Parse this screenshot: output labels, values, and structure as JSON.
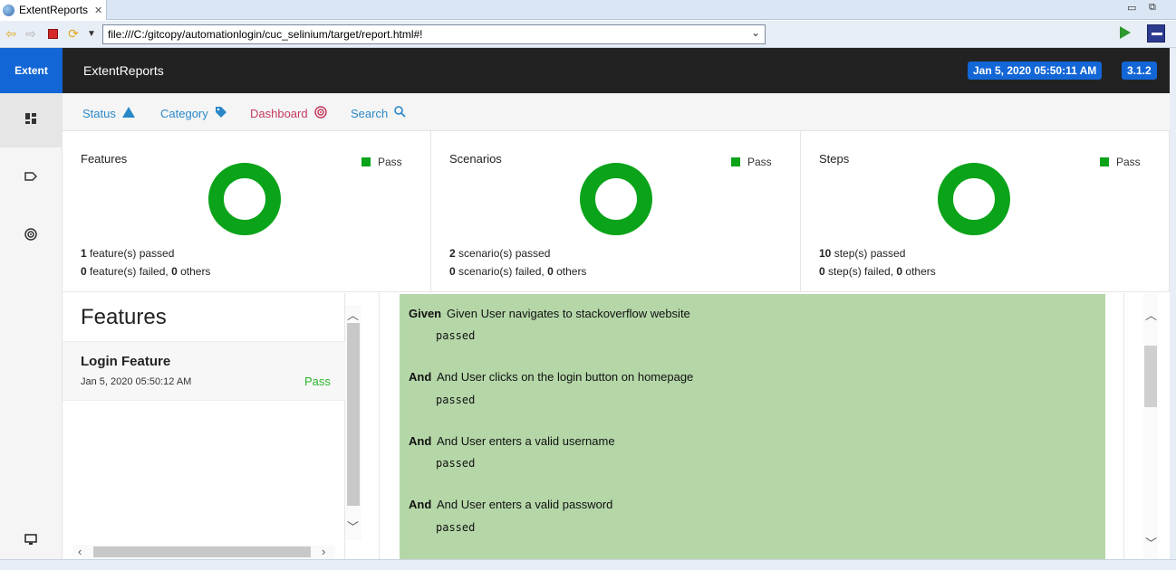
{
  "browser": {
    "tab_title": "ExtentReports",
    "url": "file:///C:/gitcopy/automationlogin/cuc_selinium/target/report.html#!"
  },
  "report": {
    "brand": "Extent",
    "title": "ExtentReports",
    "date": "Jan 5, 2020 05:50:11 AM",
    "version": "3.1.2"
  },
  "subnav": {
    "status": "Status",
    "category": "Category",
    "dashboard": "Dashboard",
    "search": "Search"
  },
  "colors": {
    "pass": "#0aa319",
    "brand": "#1366d6",
    "step_bg": "#b5d7a8"
  },
  "cards": [
    {
      "title": "Features",
      "legend": "Pass",
      "passed_count": "1",
      "passed_text": " feature(s) passed",
      "failed_count": "0",
      "failed_text": " feature(s) failed, ",
      "others_count": "0",
      "others_text": " others"
    },
    {
      "title": "Scenarios",
      "legend": "Pass",
      "passed_count": "2",
      "passed_text": " scenario(s) passed",
      "failed_count": "0",
      "failed_text": " scenario(s) failed, ",
      "others_count": "0",
      "others_text": " others"
    },
    {
      "title": "Steps",
      "legend": "Pass",
      "passed_count": "10",
      "passed_text": " step(s) passed",
      "failed_count": "0",
      "failed_text": " step(s) failed, ",
      "others_count": "0",
      "others_text": " others"
    }
  ],
  "features_list": {
    "heading": "Features",
    "items": [
      {
        "name": "Login Feature",
        "time": "Jan 5, 2020 05:50:12 AM",
        "status": "Pass"
      }
    ]
  },
  "steps": [
    {
      "keyword": "Given",
      "name": "Given User navigates to stackoverflow website",
      "status": "passed"
    },
    {
      "keyword": "And",
      "name": "And User clicks on the login button on homepage",
      "status": "passed"
    },
    {
      "keyword": "And",
      "name": "And User enters a valid username",
      "status": "passed"
    },
    {
      "keyword": "And",
      "name": "And User enters a valid password",
      "status": "passed"
    }
  ]
}
